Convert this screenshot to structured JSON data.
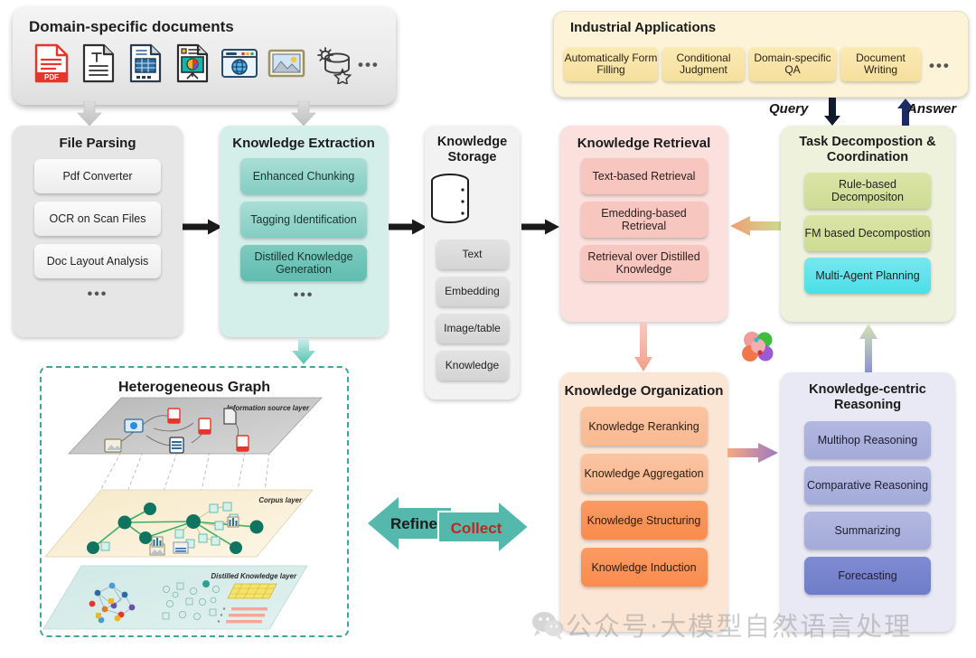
{
  "documents_bar": {
    "title": "Domain-specific documents",
    "more": "•••",
    "icons": [
      {
        "name": "pdf-document-icon",
        "label": "PDF"
      },
      {
        "name": "text-document-icon",
        "label": "T"
      },
      {
        "name": "spreadsheet-document-icon",
        "label": ""
      },
      {
        "name": "presentation-document-icon",
        "label": ""
      },
      {
        "name": "web-page-icon",
        "label": ""
      },
      {
        "name": "image-document-icon",
        "label": ""
      },
      {
        "name": "database-settings-icon",
        "label": ""
      }
    ]
  },
  "file_parsing": {
    "title": "File Parsing",
    "items": [
      "Pdf Converter",
      "OCR on Scan Files",
      "Doc Layout Analysis"
    ],
    "more": "•••"
  },
  "knowledge_extraction": {
    "title": "Knowledge Extraction",
    "items": [
      "Enhanced Chunking",
      "Tagging Identification",
      "Distilled Knowledge Generation"
    ],
    "more": "•••"
  },
  "knowledge_storage": {
    "title": "Knowledge Storage",
    "icon": "database-cylinder-icon",
    "items": [
      "Text",
      "Embedding",
      "Image/table",
      "Knowledge"
    ]
  },
  "knowledge_retrieval": {
    "title": "Knowledge Retrieval",
    "items": [
      "Text-based Retrieval",
      "Emedding-based Retrieval",
      "Retrieval over Distilled Knowledge"
    ]
  },
  "task_decomposition": {
    "title": "Task Decompostion & Coordination",
    "items": [
      "Rule-based Decompositon",
      "FM based Decompostion",
      "Multi-Agent Planning"
    ]
  },
  "industrial_applications": {
    "title": "Industrial Applications",
    "items": [
      "Automatically Form Filling",
      "Conditional Judgment",
      "Domain-specific QA",
      "Document Writing"
    ],
    "more": "•••"
  },
  "knowledge_organization": {
    "title": "Knowledge Organization",
    "items": [
      "Knowledge Reranking",
      "Knowledge Aggregation",
      "Knowledge Structuring",
      "Knowledge Induction"
    ]
  },
  "kc_reasoning": {
    "title": "Knowledge-centric Reasoning",
    "items": [
      "Multihop Reasoning",
      "Comparative Reasoning",
      "Summarizing",
      "Forecasting"
    ]
  },
  "hetero_graph": {
    "title": "Heterogeneous Graph",
    "layers": [
      "Information source layer",
      "Corpus layer",
      "Distilled Knowledge layer"
    ]
  },
  "flow_labels": {
    "query": "Query",
    "answer": "Answer",
    "refine": "Refine",
    "collect": "Collect"
  },
  "watermark": {
    "text": "公众号·大模型自然语言处理",
    "icon": "wechat-icon"
  },
  "colors": {
    "extraction_accent": "#5fbdb0",
    "retrieval_accent": "#f6c6bf",
    "decomposition_accent": "#cddb92",
    "organization_accent": "#f98c4d",
    "reasoning_accent": "#6f7cc9",
    "applications_accent": "#f5df9d",
    "graph_border": "#3fa795",
    "collect_text": "#c0271d"
  }
}
